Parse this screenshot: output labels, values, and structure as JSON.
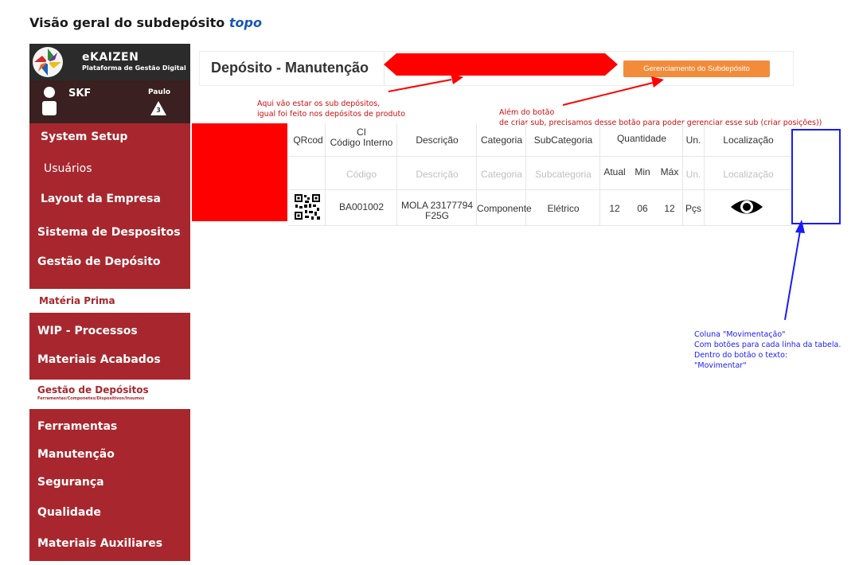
{
  "page_heading": {
    "text": "Visão geral do subdepósito",
    "link": "topo"
  },
  "brand": {
    "name": "eKAIZEN",
    "tagline": "Plataforma de Gestão Digital"
  },
  "user": {
    "company": "SKF",
    "name": "Paulo",
    "notifications": "3"
  },
  "sidebar": {
    "items": [
      {
        "label": "System Setup"
      },
      {
        "label": "Usuários"
      },
      {
        "label": "Layout da Empresa"
      },
      {
        "label": "Sistema de Despositos"
      },
      {
        "label": "Gestão de Depósito"
      },
      {
        "label": "Matéria Prima"
      },
      {
        "label": "WIP - Processos"
      },
      {
        "label": "Materiais Acabados"
      },
      {
        "label": "Gestão de Depósitos",
        "sub": "Ferramentas/Componetes/Dispositivos/Insumos"
      },
      {
        "label": "Ferramentas"
      },
      {
        "label": "Manutenção"
      },
      {
        "label": "Segurança"
      },
      {
        "label": "Qualidade"
      },
      {
        "label": "Materiais Auxiliares"
      }
    ]
  },
  "header": {
    "title": "Depósito - Manutenção",
    "manage_button": "Gerenciamento do Subdepósito"
  },
  "annotations": {
    "sub_deposits": [
      "Aqui vão estar os sub depósitos,",
      "igual foi feito nos depósitos de produto"
    ],
    "button_note": [
      "Além do botão",
      "de criar sub, precisamos desse botão para poder gerenciar esse sub (criar posições))"
    ],
    "column_note": [
      "Coluna \"Movimentação\"",
      "Com botões para cada linha da tabela.",
      "Dentro do botão o texto:",
      "\"Movimentar\""
    ]
  },
  "table": {
    "headers": {
      "qrcode": "QRcod",
      "ci": [
        "CI",
        "Código Interno"
      ],
      "descricao": "Descrição",
      "categoria": "Categoria",
      "subcategoria": "SubCategoria",
      "quantidade": "Quantidade",
      "un": "Un.",
      "localizacao": "Localização"
    },
    "subheaders": {
      "atual": "Atual",
      "min": "Min",
      "max": "Máx"
    },
    "filters": {
      "codigo": "Código",
      "descricao": "Descrição",
      "categoria": "Categoria",
      "subcategoria": "Subcategoria",
      "un": "Un.",
      "localizacao": "Localização"
    },
    "rows": [
      {
        "codigo": "BA001002",
        "descricao": [
          "MOLA 23177794",
          "F25G"
        ],
        "categoria": "Componente",
        "subcategoria": "Elétrico",
        "atual": "12",
        "min": "06",
        "max": "12",
        "un": "Pçs"
      }
    ]
  },
  "colors": {
    "sidebar": "#a8272e",
    "brand_bar": "#2b2b2b",
    "button": "#f28c3a",
    "annot_red": "#d10f0f",
    "annot_blue": "#1a1aff"
  }
}
